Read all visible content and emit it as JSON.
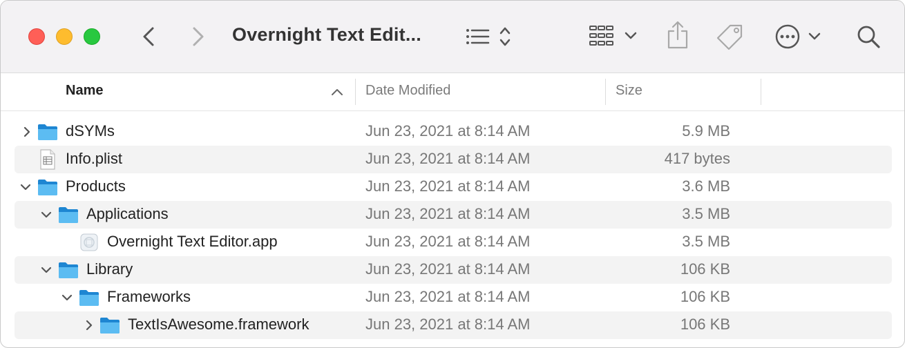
{
  "window": {
    "title": "Overnight Text Edit...",
    "toolbar": {
      "back_icon": "chevron-left-icon",
      "forward_icon": "chevron-right-icon",
      "view_icon": "list-view-icon",
      "group_icon": "grid-icon",
      "share_icon": "share-icon",
      "tag_icon": "tag-icon",
      "more_icon": "ellipsis-circle-icon",
      "search_icon": "magnifier-icon"
    }
  },
  "columns": {
    "name": "Name",
    "date": "Date Modified",
    "size": "Size"
  },
  "rows": [
    {
      "name": "dSYMs",
      "date": "Jun 23, 2021 at 8:14 AM",
      "size": "5.9 MB",
      "kind": "folder",
      "expanded": false
    },
    {
      "name": "Info.plist",
      "date": "Jun 23, 2021 at 8:14 AM",
      "size": "417 bytes",
      "kind": "plist"
    },
    {
      "name": "Products",
      "date": "Jun 23, 2021 at 8:14 AM",
      "size": "3.6 MB",
      "kind": "folder",
      "expanded": true
    },
    {
      "name": "Applications",
      "date": "Jun 23, 2021 at 8:14 AM",
      "size": "3.5 MB",
      "kind": "folder",
      "expanded": true
    },
    {
      "name": "Overnight Text Editor.app",
      "date": "Jun 23, 2021 at 8:14 AM",
      "size": "3.5 MB",
      "kind": "app"
    },
    {
      "name": "Library",
      "date": "Jun 23, 2021 at 8:14 AM",
      "size": "106 KB",
      "kind": "folder",
      "expanded": true
    },
    {
      "name": "Frameworks",
      "date": "Jun 23, 2021 at 8:14 AM",
      "size": "106 KB",
      "kind": "folder",
      "expanded": true
    },
    {
      "name": "TextIsAwesome.framework",
      "date": "Jun 23, 2021 at 8:14 AM",
      "size": "106 KB",
      "kind": "folder",
      "expanded": false
    }
  ],
  "colors": {
    "close": "#ff5f57",
    "minimize": "#febc2e",
    "zoom": "#28c840",
    "folder": "#3aa7e8",
    "stripe": "#f3f3f3"
  }
}
